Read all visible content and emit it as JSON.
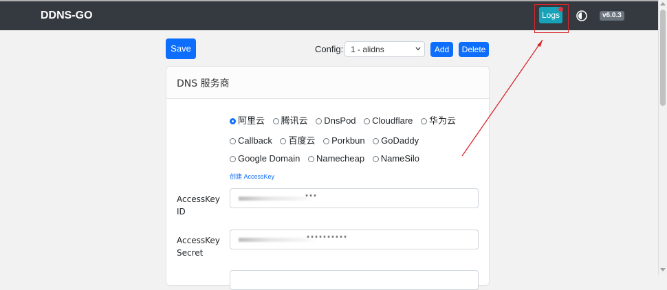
{
  "navbar": {
    "brand": "DDNS-GO",
    "logs_label": "Logs",
    "version": "v6.0.3",
    "theme_icon": "theme-toggle-icon",
    "highlight_color": "#d9262c"
  },
  "toolbar": {
    "save_label": "Save",
    "config_label": "Config:",
    "config_value": "1 - alidns",
    "add_label": "Add",
    "delete_label": "Delete"
  },
  "dns_card": {
    "title": "DNS 服务商",
    "providers": [
      {
        "label": "阿里云",
        "checked": true
      },
      {
        "label": "腾讯云",
        "checked": false
      },
      {
        "label": "DnsPod",
        "checked": false
      },
      {
        "label": "Cloudflare",
        "checked": false
      },
      {
        "label": "华为云",
        "checked": false
      },
      {
        "label": "Callback",
        "checked": false
      },
      {
        "label": "百度云",
        "checked": false
      },
      {
        "label": "Porkbun",
        "checked": false
      },
      {
        "label": "GoDaddy",
        "checked": false
      },
      {
        "label": "Google Domain",
        "checked": false
      },
      {
        "label": "Namecheap",
        "checked": false
      },
      {
        "label": "NameSilo",
        "checked": false
      }
    ],
    "create_link": "创建 AccessKey",
    "access_key_id_label": "AccessKey ID",
    "access_key_id_value": "***",
    "access_key_secret_label": "AccessKey Secret",
    "access_key_secret_value": "**********"
  },
  "colors": {
    "navbar_bg": "#343a40",
    "primary": "#0d6efd",
    "info": "#17a2b8",
    "badge": "#6c757d"
  }
}
